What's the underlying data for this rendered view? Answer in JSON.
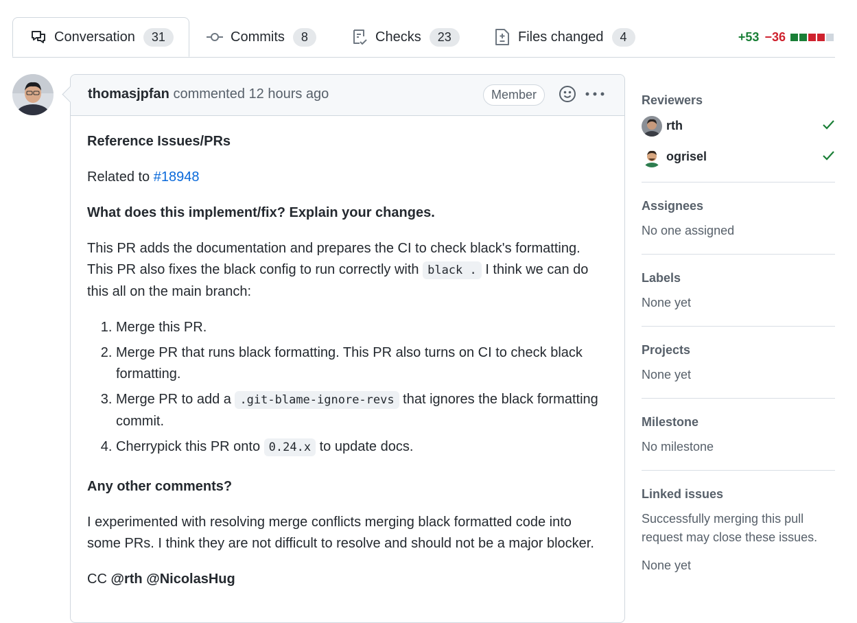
{
  "tabs": [
    {
      "label": "Conversation",
      "count": "31"
    },
    {
      "label": "Commits",
      "count": "8"
    },
    {
      "label": "Checks",
      "count": "23"
    },
    {
      "label": "Files changed",
      "count": "4"
    }
  ],
  "diffstat": {
    "additions": "+53",
    "deletions": "−36"
  },
  "comment": {
    "author": "thomasjpfan",
    "action": "commented 12 hours ago",
    "badge": "Member",
    "h1": "Reference Issues/PRs",
    "related_prefix": "Related to",
    "related_link": "#18948",
    "h2": "What does this implement/fix? Explain your changes.",
    "para1_a": "This PR adds the documentation and prepares the CI to check black's formatting. This PR also fixes the black config to run correctly with",
    "para1_code": "black .",
    "para1_b": "I think we can do this all on the main branch:",
    "item1": "Merge this PR.",
    "item2": "Merge PR that runs black formatting. This PR also turns on CI to check black formatting.",
    "item3_a": "Merge PR to add a",
    "item3_code": ".git-blame-ignore-revs",
    "item3_b": "that ignores the black formatting commit.",
    "item4_a": "Cherrypick this PR onto",
    "item4_code": "0.24.x",
    "item4_b": "to update docs.",
    "h3": "Any other comments?",
    "para2": "I experimented with resolving merge conflicts merging black formatted code into some PRs. I think they are not difficult to resolve and should not be a major blocker.",
    "cc": "CC",
    "mention1": "@rth",
    "mention2": "@NicolasHug"
  },
  "sidebar": {
    "reviewers_title": "Reviewers",
    "reviewers": [
      {
        "name": "rth"
      },
      {
        "name": "ogrisel"
      }
    ],
    "assignees_title": "Assignees",
    "assignees_value": "No one assigned",
    "labels_title": "Labels",
    "labels_value": "None yet",
    "projects_title": "Projects",
    "projects_value": "None yet",
    "milestone_title": "Milestone",
    "milestone_value": "No milestone",
    "linked_title": "Linked issues",
    "linked_desc": "Successfully merging this pull request may close these issues.",
    "linked_value": "None yet"
  },
  "colors": {
    "addition": "#1a7f37",
    "deletion": "#cf222e",
    "link": "#0969da",
    "approved": "#1a7f37"
  }
}
